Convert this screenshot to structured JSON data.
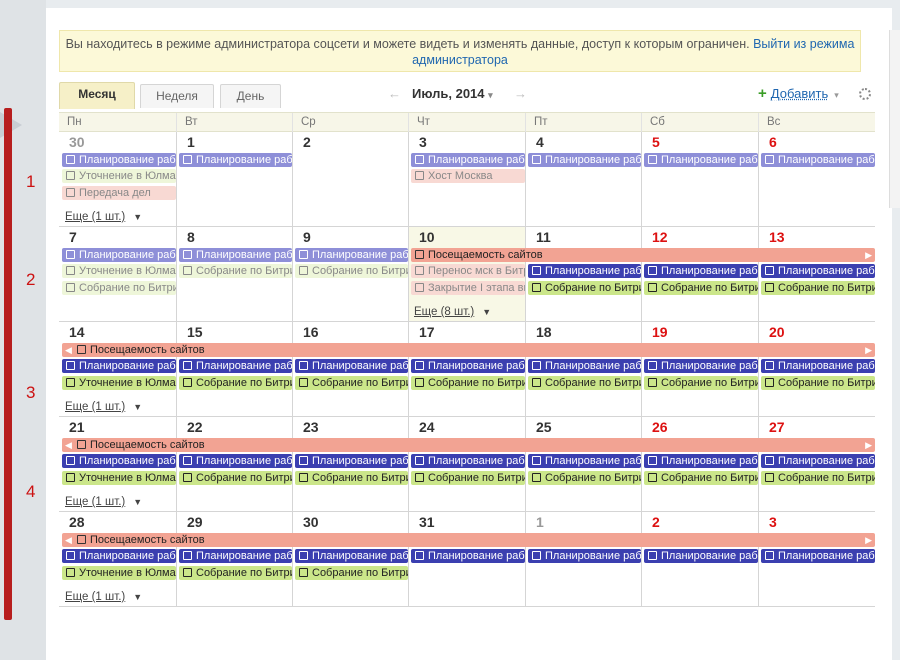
{
  "annotations": {
    "row_labels": [
      "1",
      "2",
      "3",
      "4"
    ]
  },
  "notice": {
    "text": "Вы находитесь в режиме администратора соцсети и можете видеть и изменять данные, доступ к которым ограничен.",
    "link": "Выйти из режима администратора"
  },
  "tabs": [
    "Месяц",
    "Неделя",
    "День"
  ],
  "nav": {
    "prev": "←",
    "title": "Июль, 2014",
    "title_caret": "▾",
    "next": "→"
  },
  "add": {
    "plus": "+",
    "label": "Добавить",
    "caret": "▾"
  },
  "weekdays": [
    "Пн",
    "Вт",
    "Ср",
    "Чт",
    "Пт",
    "Сб",
    "Вс"
  ],
  "weeks": [
    {
      "days": [
        {
          "num": "30",
          "type": "other"
        },
        {
          "num": "1",
          "type": "normal"
        },
        {
          "num": "2",
          "type": "normal"
        },
        {
          "num": "3",
          "type": "normal"
        },
        {
          "num": "4",
          "type": "normal"
        },
        {
          "num": "5",
          "type": "red"
        },
        {
          "num": "6",
          "type": "red"
        }
      ],
      "more": "Еще (1 шт.)"
    },
    {
      "days": [
        {
          "num": "7",
          "type": "normal"
        },
        {
          "num": "8",
          "type": "normal"
        },
        {
          "num": "9",
          "type": "normal"
        },
        {
          "num": "10",
          "type": "normal"
        },
        {
          "num": "11",
          "type": "normal"
        },
        {
          "num": "12",
          "type": "red"
        },
        {
          "num": "13",
          "type": "red"
        }
      ],
      "more": "Еще (8 шт.)"
    },
    {
      "days": [
        {
          "num": "14",
          "type": "normal"
        },
        {
          "num": "15",
          "type": "normal"
        },
        {
          "num": "16",
          "type": "normal"
        },
        {
          "num": "17",
          "type": "normal"
        },
        {
          "num": "18",
          "type": "normal"
        },
        {
          "num": "19",
          "type": "red"
        },
        {
          "num": "20",
          "type": "red"
        }
      ],
      "more": "Еще (1 шт.)"
    },
    {
      "days": [
        {
          "num": "21",
          "type": "normal"
        },
        {
          "num": "22",
          "type": "normal"
        },
        {
          "num": "23",
          "type": "normal"
        },
        {
          "num": "24",
          "type": "normal"
        },
        {
          "num": "25",
          "type": "normal"
        },
        {
          "num": "26",
          "type": "red"
        },
        {
          "num": "27",
          "type": "red"
        }
      ],
      "more": "Еще (1 шт.)"
    },
    {
      "days": [
        {
          "num": "28",
          "type": "normal"
        },
        {
          "num": "29",
          "type": "normal"
        },
        {
          "num": "30",
          "type": "normal"
        },
        {
          "num": "31",
          "type": "normal"
        },
        {
          "num": "1",
          "type": "other"
        },
        {
          "num": "2",
          "type": "red"
        },
        {
          "num": "3",
          "type": "red"
        }
      ],
      "more": "Еще (1 шт.)"
    }
  ],
  "events": {
    "planning": "Планирование работ",
    "clarify": "Уточнение в Юлмарт",
    "handover": "Передача дел",
    "host": "Хост Москва",
    "meeting": "Собрание по Битрикс",
    "attendance": "Посещаемость сайтов",
    "move": "Перенос мск в Битрикс",
    "close": "Закрытие I этапа внедрения"
  }
}
